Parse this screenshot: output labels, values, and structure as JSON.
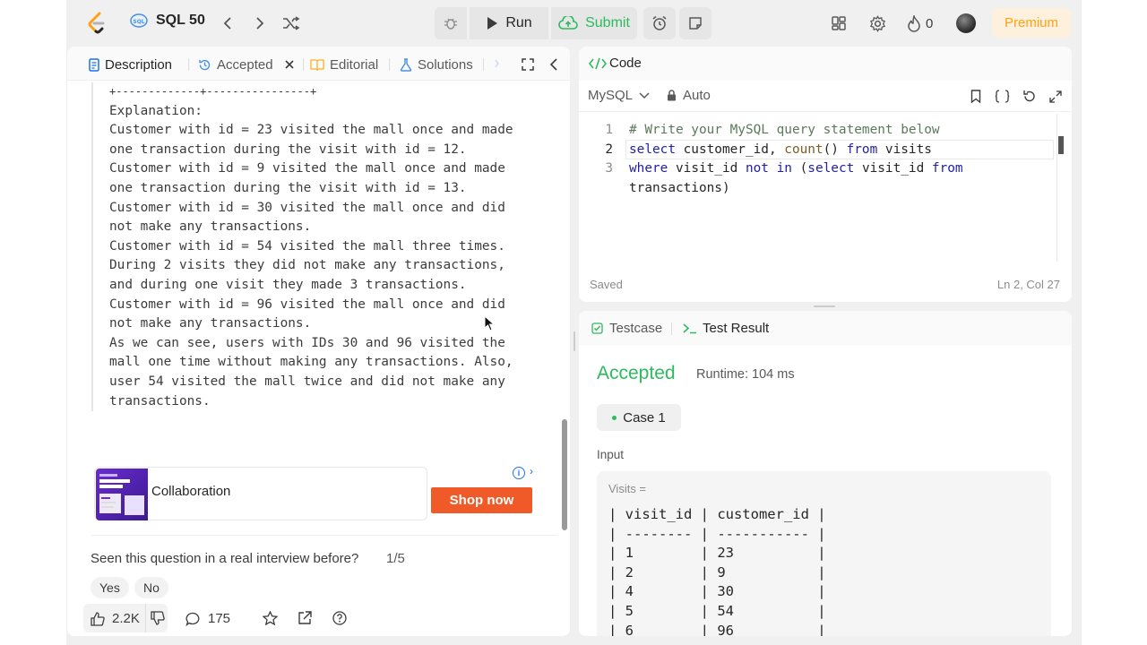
{
  "topnav": {
    "list_name": "SQL 50",
    "run_label": "Run",
    "submit_label": "Submit",
    "streak_count": "0",
    "premium_label": "Premium"
  },
  "left_tabs": {
    "description": "Description",
    "accepted": "Accepted",
    "editorial": "Editorial",
    "solutions": "Solutions"
  },
  "explanation": {
    "lines": [
      "+-------------+----------------+",
      "Explanation:",
      "Customer with id = 23 visited the mall once and made",
      "one transaction during the visit with id = 12.",
      "Customer with id = 9 visited the mall once and made",
      "one transaction during the visit with id = 13.",
      "Customer with id = 30 visited the mall once and did",
      "not make any transactions.",
      "Customer with id = 54 visited the mall three times.",
      "During 2 visits they did not make any transactions,",
      "and during one visit they made 3 transactions.",
      "Customer with id = 96 visited the mall once and did",
      "not make any transactions.",
      "As we can see, users with IDs 30 and 96 visited the",
      "mall one time without making any transactions. Also,",
      "user 54 visited the mall twice and did not make any",
      "transactions."
    ]
  },
  "ad": {
    "text": "Collaboration",
    "button": "Shop now"
  },
  "feedback": {
    "question": "Seen this question in a real interview before?",
    "count": "1/5",
    "yes": "Yes",
    "no": "No"
  },
  "stats": {
    "likes": "2.2K",
    "comments": "175"
  },
  "code_panel": {
    "title": "Code",
    "language": "MySQL",
    "mode": "Auto",
    "line_numbers": [
      "1",
      "2",
      "3"
    ],
    "status": "Saved",
    "cursor_pos": "Ln 2, Col 27"
  },
  "result_panel": {
    "testcase_tab": "Testcase",
    "result_tab": "Test Result",
    "verdict": "Accepted",
    "runtime": "Runtime: 104 ms",
    "case_label": "Case 1",
    "input_label": "Input",
    "table_name": "Visits =",
    "table_lines": [
      "| visit_id | customer_id |",
      "| -------- | ----------- |",
      "| 1        | 23          |",
      "| 2        | 9           |",
      "| 4        | 30          |",
      "| 5        | 54          |",
      "| 6        | 96          |"
    ]
  },
  "colors": {
    "accent_green": "#2cbb5d",
    "premium_orange": "#ffa116",
    "shop_button": "#f05a28"
  }
}
